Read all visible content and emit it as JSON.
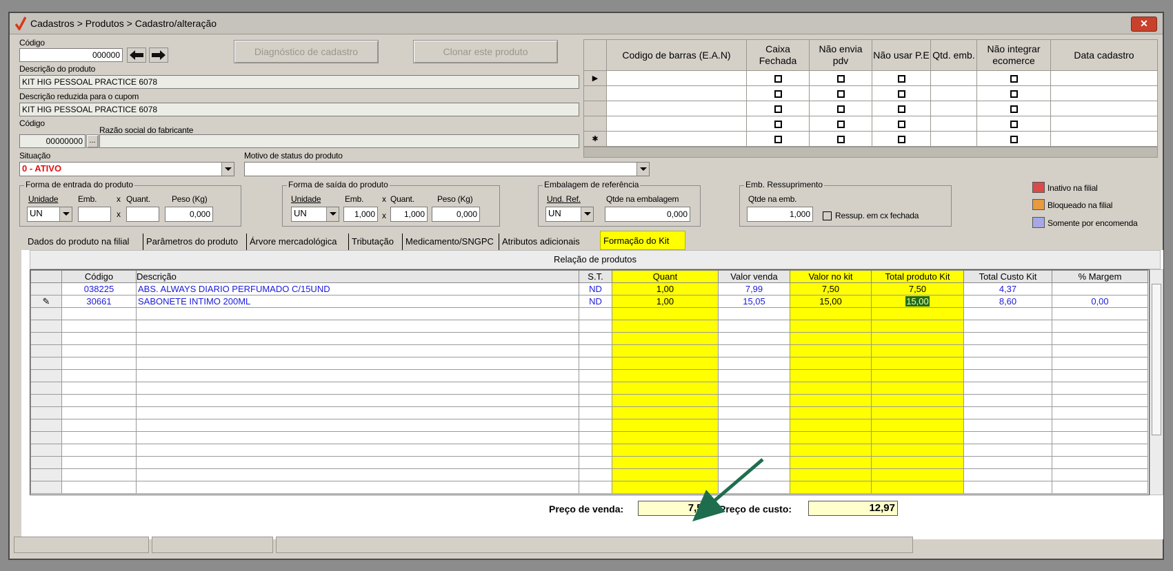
{
  "window": {
    "title": "Cadastros > Produtos > Cadastro/alteração",
    "close_label": "✕"
  },
  "header": {
    "codigo_label": "Código",
    "codigo_value": "000000",
    "diag_button": "Diagnóstico de cadastro",
    "clone_button": "Clonar este produto",
    "descricao_label": "Descrição  do produto",
    "descricao_value": "KIT HIG PESSOAL PRACTICE 6078",
    "desc_reduzida_label": "Descrição reduzida para o cupom",
    "desc_reduzida_value": "KIT HIG PESSOAL PRACTICE 6078",
    "fab_codigo_label": "Código",
    "fab_codigo_value": "00000000",
    "fab_lookup": "...",
    "razao_label": "Razão social do fabricante",
    "situacao_label": "Situação",
    "situacao_value": "0 - ATIVO",
    "motivo_label": "Motivo de status do produto"
  },
  "ean_table": {
    "headers": [
      "Codigo de barras (E.A.N)",
      "Caixa Fechada",
      "Não envia pdv",
      "Não usar P.E",
      "Qtd. emb.",
      "Não integrar ecomerce",
      "Data cadastro"
    ],
    "indicators": [
      "▶",
      "",
      "",
      "",
      "✱"
    ]
  },
  "entrada": {
    "title": "Forma de entrada do produto",
    "unidade_label": "Unidade",
    "emb_label": "Emb.",
    "x": "x",
    "quant_label": "Quant.",
    "peso_label": "Peso (Kg)",
    "unidade_value": "UN",
    "peso_value": "0,000"
  },
  "saida": {
    "title": "Forma de saída do produto",
    "unidade_label": "Unidade",
    "emb_label": "Emb.",
    "x": "x",
    "quant_label": "Quant.",
    "peso_label": "Peso (Kg)",
    "unidade_value": "UN",
    "emb_value": "1,000",
    "quant_value": "1,000",
    "peso_value": "0,000"
  },
  "embalagem": {
    "title": "Embalagem de referência",
    "und_label": "Und. Ref.",
    "qtde_label": "Qtde na embalagem",
    "und_value": "UN",
    "qtde_value": "0,000"
  },
  "ressup": {
    "title": "Emb. Ressuprimento",
    "qtde_label": "Qtde na emb.",
    "qtde_value": "1,000",
    "chk_label": "Ressup. em cx fechada"
  },
  "legend": {
    "items": [
      {
        "label": "Inativo na filial",
        "color": "#d94a4a"
      },
      {
        "label": "Bloqueado na filial",
        "color": "#e89a3c"
      },
      {
        "label": "Somente por encomenda",
        "color": "#a7a7e6"
      }
    ]
  },
  "tabs": [
    "Dados do produto na filial",
    "Parâmetros do produto",
    "Árvore mercadológica",
    "Tributação",
    "Medicamento/SNGPC",
    "Atributos adicionais",
    "Formação do Kit"
  ],
  "kit": {
    "title": "Relação de produtos",
    "columns": [
      "",
      "Código",
      "Descrição",
      "S.T.",
      "Quant",
      "Valor venda",
      "Valor no kit",
      "Total produto Kit",
      "Total Custo Kit",
      "% Margem"
    ],
    "rows": [
      {
        "ind": "",
        "codigo": "038225",
        "descricao": "ABS. ALWAYS DIARIO PERFUMADO C/15UND",
        "st": "ND",
        "quant": "1,00",
        "valor_venda": "7,99",
        "valor_kit": "7,50",
        "total_kit": "7,50",
        "custo_kit": "4,37",
        "margem": ""
      },
      {
        "ind": "✎",
        "codigo": "30661",
        "descricao": "SABONETE INTIMO 200ML",
        "st": "ND",
        "quant": "1,00",
        "valor_venda": "15,05",
        "valor_kit": "15,00",
        "total_kit": "15,00",
        "custo_kit": "8,60",
        "margem": "0,00"
      }
    ],
    "preco_venda_label": "Preço de venda:",
    "preco_venda_value": "7,50",
    "preco_custo_label": "Preço de custo:",
    "preco_custo_value": "12,97"
  },
  "colors": {
    "highlight": "#ffff00",
    "annotation_arrow": "#1e6e4e",
    "link_blue": "#1a1adb"
  }
}
